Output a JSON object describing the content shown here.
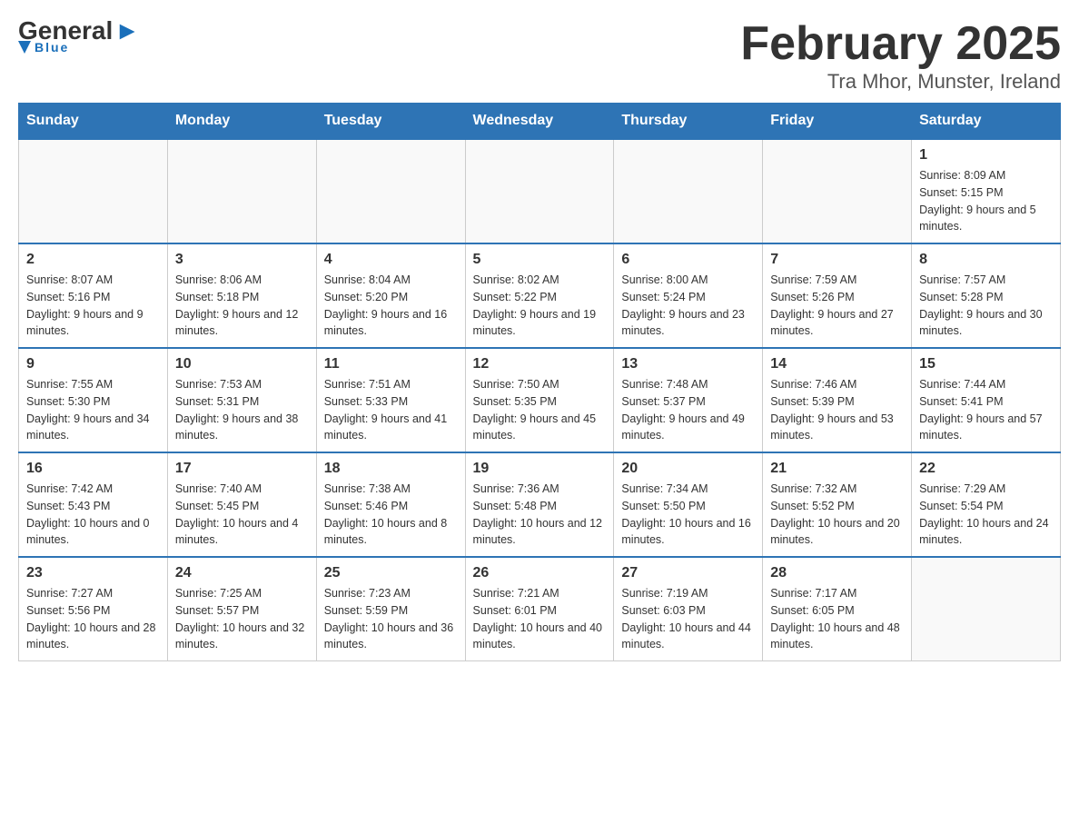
{
  "logo": {
    "text1": "General",
    "text2": "Blue"
  },
  "title": "February 2025",
  "subtitle": "Tra Mhor, Munster, Ireland",
  "days_of_week": [
    "Sunday",
    "Monday",
    "Tuesday",
    "Wednesday",
    "Thursday",
    "Friday",
    "Saturday"
  ],
  "weeks": [
    [
      {
        "day": "",
        "info": ""
      },
      {
        "day": "",
        "info": ""
      },
      {
        "day": "",
        "info": ""
      },
      {
        "day": "",
        "info": ""
      },
      {
        "day": "",
        "info": ""
      },
      {
        "day": "",
        "info": ""
      },
      {
        "day": "1",
        "info": "Sunrise: 8:09 AM\nSunset: 5:15 PM\nDaylight: 9 hours and 5 minutes."
      }
    ],
    [
      {
        "day": "2",
        "info": "Sunrise: 8:07 AM\nSunset: 5:16 PM\nDaylight: 9 hours and 9 minutes."
      },
      {
        "day": "3",
        "info": "Sunrise: 8:06 AM\nSunset: 5:18 PM\nDaylight: 9 hours and 12 minutes."
      },
      {
        "day": "4",
        "info": "Sunrise: 8:04 AM\nSunset: 5:20 PM\nDaylight: 9 hours and 16 minutes."
      },
      {
        "day": "5",
        "info": "Sunrise: 8:02 AM\nSunset: 5:22 PM\nDaylight: 9 hours and 19 minutes."
      },
      {
        "day": "6",
        "info": "Sunrise: 8:00 AM\nSunset: 5:24 PM\nDaylight: 9 hours and 23 minutes."
      },
      {
        "day": "7",
        "info": "Sunrise: 7:59 AM\nSunset: 5:26 PM\nDaylight: 9 hours and 27 minutes."
      },
      {
        "day": "8",
        "info": "Sunrise: 7:57 AM\nSunset: 5:28 PM\nDaylight: 9 hours and 30 minutes."
      }
    ],
    [
      {
        "day": "9",
        "info": "Sunrise: 7:55 AM\nSunset: 5:30 PM\nDaylight: 9 hours and 34 minutes."
      },
      {
        "day": "10",
        "info": "Sunrise: 7:53 AM\nSunset: 5:31 PM\nDaylight: 9 hours and 38 minutes."
      },
      {
        "day": "11",
        "info": "Sunrise: 7:51 AM\nSunset: 5:33 PM\nDaylight: 9 hours and 41 minutes."
      },
      {
        "day": "12",
        "info": "Sunrise: 7:50 AM\nSunset: 5:35 PM\nDaylight: 9 hours and 45 minutes."
      },
      {
        "day": "13",
        "info": "Sunrise: 7:48 AM\nSunset: 5:37 PM\nDaylight: 9 hours and 49 minutes."
      },
      {
        "day": "14",
        "info": "Sunrise: 7:46 AM\nSunset: 5:39 PM\nDaylight: 9 hours and 53 minutes."
      },
      {
        "day": "15",
        "info": "Sunrise: 7:44 AM\nSunset: 5:41 PM\nDaylight: 9 hours and 57 minutes."
      }
    ],
    [
      {
        "day": "16",
        "info": "Sunrise: 7:42 AM\nSunset: 5:43 PM\nDaylight: 10 hours and 0 minutes."
      },
      {
        "day": "17",
        "info": "Sunrise: 7:40 AM\nSunset: 5:45 PM\nDaylight: 10 hours and 4 minutes."
      },
      {
        "day": "18",
        "info": "Sunrise: 7:38 AM\nSunset: 5:46 PM\nDaylight: 10 hours and 8 minutes."
      },
      {
        "day": "19",
        "info": "Sunrise: 7:36 AM\nSunset: 5:48 PM\nDaylight: 10 hours and 12 minutes."
      },
      {
        "day": "20",
        "info": "Sunrise: 7:34 AM\nSunset: 5:50 PM\nDaylight: 10 hours and 16 minutes."
      },
      {
        "day": "21",
        "info": "Sunrise: 7:32 AM\nSunset: 5:52 PM\nDaylight: 10 hours and 20 minutes."
      },
      {
        "day": "22",
        "info": "Sunrise: 7:29 AM\nSunset: 5:54 PM\nDaylight: 10 hours and 24 minutes."
      }
    ],
    [
      {
        "day": "23",
        "info": "Sunrise: 7:27 AM\nSunset: 5:56 PM\nDaylight: 10 hours and 28 minutes."
      },
      {
        "day": "24",
        "info": "Sunrise: 7:25 AM\nSunset: 5:57 PM\nDaylight: 10 hours and 32 minutes."
      },
      {
        "day": "25",
        "info": "Sunrise: 7:23 AM\nSunset: 5:59 PM\nDaylight: 10 hours and 36 minutes."
      },
      {
        "day": "26",
        "info": "Sunrise: 7:21 AM\nSunset: 6:01 PM\nDaylight: 10 hours and 40 minutes."
      },
      {
        "day": "27",
        "info": "Sunrise: 7:19 AM\nSunset: 6:03 PM\nDaylight: 10 hours and 44 minutes."
      },
      {
        "day": "28",
        "info": "Sunrise: 7:17 AM\nSunset: 6:05 PM\nDaylight: 10 hours and 48 minutes."
      },
      {
        "day": "",
        "info": ""
      }
    ]
  ]
}
